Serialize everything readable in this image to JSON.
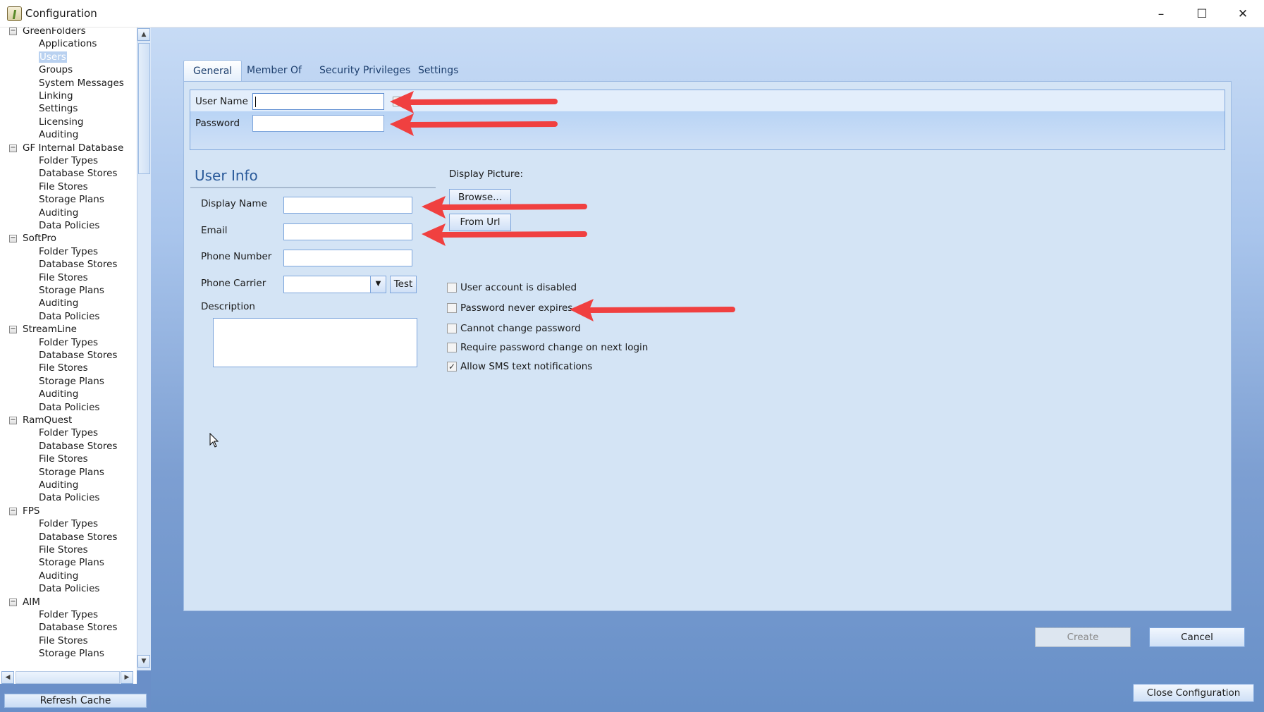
{
  "window": {
    "title": "Configuration",
    "minimize": "–",
    "maximize": "☐",
    "close": "✕"
  },
  "sidebar": {
    "groups": [
      {
        "label": "GreenFolders",
        "items": [
          "Applications",
          "Users",
          "Groups",
          "System Messages",
          "Linking",
          "Settings",
          "Licensing",
          "Auditing"
        ]
      },
      {
        "label": "GF Internal Database",
        "items": [
          "Folder Types",
          "Database Stores",
          "File Stores",
          "Storage Plans",
          "Auditing",
          "Data Policies"
        ]
      },
      {
        "label": "SoftPro",
        "items": [
          "Folder Types",
          "Database Stores",
          "File Stores",
          "Storage Plans",
          "Auditing",
          "Data Policies"
        ]
      },
      {
        "label": "StreamLine",
        "items": [
          "Folder Types",
          "Database Stores",
          "File Stores",
          "Storage Plans",
          "Auditing",
          "Data Policies"
        ]
      },
      {
        "label": "RamQuest",
        "items": [
          "Folder Types",
          "Database Stores",
          "File Stores",
          "Storage Plans",
          "Auditing",
          "Data Policies"
        ]
      },
      {
        "label": "FPS",
        "items": [
          "Folder Types",
          "Database Stores",
          "File Stores",
          "Storage Plans",
          "Auditing",
          "Data Policies"
        ]
      },
      {
        "label": "AIM",
        "items": [
          "Folder Types",
          "Database Stores",
          "File Stores",
          "Storage Plans"
        ]
      }
    ],
    "selected": "Users",
    "refresh_label": "Refresh Cache"
  },
  "tabs": [
    {
      "label": "General",
      "active": true
    },
    {
      "label": "Member Of"
    },
    {
      "label": "Security Privileges"
    },
    {
      "label": "Settings"
    }
  ],
  "login": {
    "username_label": "User Name",
    "username_value": "",
    "password_label": "Password",
    "password_value": ""
  },
  "user_info": {
    "heading": "User Info",
    "display_name_label": "Display Name",
    "display_name_value": "",
    "email_label": "Email",
    "email_value": "",
    "phone_label": "Phone Number",
    "phone_value": "",
    "carrier_label": "Phone Carrier",
    "carrier_value": "",
    "test_label": "Test",
    "description_label": "Description",
    "description_value": ""
  },
  "picture": {
    "label": "Display Picture:",
    "browse_label": "Browse...",
    "url_label": "From Url"
  },
  "options": [
    {
      "label": "User account is disabled",
      "checked": false
    },
    {
      "label": "Password never expires",
      "checked": false
    },
    {
      "label": "Cannot change password",
      "checked": false
    },
    {
      "label": "Require password change on next login",
      "checked": false
    },
    {
      "label": "Allow SMS text notifications",
      "checked": true
    }
  ],
  "footer": {
    "create_label": "Create",
    "cancel_label": "Cancel",
    "close_label": "Close Configuration"
  },
  "colors": {
    "accent": "#6890c8",
    "annotation_arrow": "#f04040"
  }
}
